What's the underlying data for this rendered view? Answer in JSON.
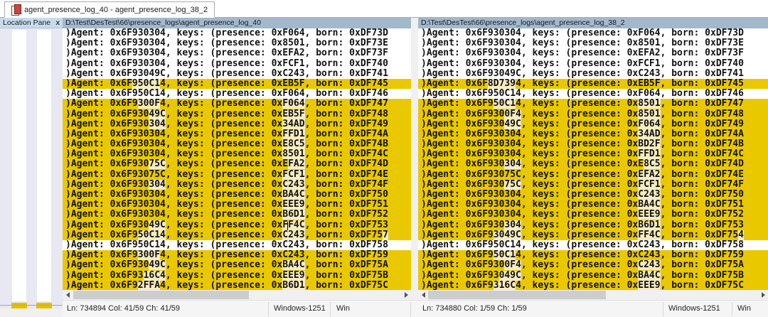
{
  "window": {
    "tab_title": "agent_presence_log_40 - agent_presence_log_38_2"
  },
  "location_pane": {
    "title": "Location Pane",
    "close_label": "x"
  },
  "colors": {
    "diff_background": "#EAC800",
    "word_diff_background": "#F6ECC0",
    "header_background": "#A3B8CC",
    "location_marker": "#E3C000"
  },
  "panes": [
    {
      "path": "D:\\Test\\DesTest\\66\\presence_logs\\agent_presence_log_40",
      "status": {
        "line_info": "Ln: 734894  Col: 41/59  Ch: 41/59",
        "encoding": "Windows-1251",
        "eol": "Win"
      },
      "lines": [
        {
          "d": 0,
          "s": [
            [
              ")Agent: 0x6F930304, keys: (presence: 0xF064, born: 0xDF73D",
              0
            ]
          ]
        },
        {
          "d": 0,
          "s": [
            [
              ")Agent: 0x6F930304, keys: (presence: 0x8501, born: 0xDF73E",
              0
            ]
          ]
        },
        {
          "d": 0,
          "s": [
            [
              ")Agent: 0x6F930304, keys: (presence: 0xEFA2, born: 0xDF73F",
              0
            ]
          ]
        },
        {
          "d": 0,
          "s": [
            [
              ")Agent: 0x6F930304, keys: (presence: 0xFCF1, born: 0xDF740",
              0
            ]
          ]
        },
        {
          "d": 0,
          "s": [
            [
              ")Agent: 0x6F93049C, keys: (presence: 0xC243, born: 0xDF741",
              0
            ]
          ]
        },
        {
          "d": 1,
          "s": [
            [
              ")Agent: 0x6F",
              0
            ],
            [
              "950C1",
              1
            ],
            [
              "4, keys: (presence: 0xEB5F, born: 0xDF745",
              0
            ]
          ]
        },
        {
          "d": 0,
          "s": [
            [
              ")Agent: 0x6F950C14, keys: (presence: 0xF064, born: 0xDF746",
              0
            ]
          ]
        },
        {
          "d": 1,
          "s": [
            [
              ")Agent: 0x6F9",
              0
            ],
            [
              "300F",
              1
            ],
            [
              "4, keys: (presence: 0x",
              0
            ],
            [
              "F064",
              1
            ],
            [
              ", born: 0xDF747",
              0
            ]
          ]
        },
        {
          "d": 1,
          "s": [
            [
              ")Agent: 0x6F930",
              0
            ],
            [
              "49C",
              1
            ],
            [
              ", keys: (presence: 0x",
              0
            ],
            [
              "EB5F",
              1
            ],
            [
              ", born: 0xDF748",
              0
            ]
          ]
        },
        {
          "d": 1,
          "s": [
            [
              ")Agent: 0x6F930",
              0
            ],
            [
              "304",
              1
            ],
            [
              ", keys: (presence: 0x",
              0
            ],
            [
              "34AD",
              1
            ],
            [
              ", born: 0xDF749",
              0
            ]
          ]
        },
        {
          "d": 1,
          "s": [
            [
              ")Agent: 0x6F930304, keys: (presence: 0x",
              0
            ],
            [
              "FFD1",
              1
            ],
            [
              ", born: 0xDF74A",
              0
            ]
          ]
        },
        {
          "d": 1,
          "s": [
            [
              ")Agent: 0x6F930304, keys: (presence: 0x",
              0
            ],
            [
              "E8C5",
              1
            ],
            [
              ", born: 0xDF74B",
              0
            ]
          ]
        },
        {
          "d": 1,
          "s": [
            [
              ")Agent: 0x6F930304, keys: (presence: 0x",
              0
            ],
            [
              "8501",
              1
            ],
            [
              ", born: 0xDF74C",
              0
            ]
          ]
        },
        {
          "d": 1,
          "s": [
            [
              ")Agent: 0x6F930",
              0
            ],
            [
              "75C",
              1
            ],
            [
              ", keys: (presence: 0xE",
              0
            ],
            [
              "FA2",
              1
            ],
            [
              ", born: 0xDF74D",
              0
            ]
          ]
        },
        {
          "d": 1,
          "s": [
            [
              ")Agent: 0x6F93075C, keys: (presence: 0x",
              0
            ],
            [
              "FCF1",
              1
            ],
            [
              ", born: 0xDF74E",
              0
            ]
          ]
        },
        {
          "d": 1,
          "s": [
            [
              ")Agent: 0x6F930",
              0
            ],
            [
              "304",
              1
            ],
            [
              ", keys: (presence: 0x",
              0
            ],
            [
              "C243",
              1
            ],
            [
              ", born: 0xDF74F",
              0
            ]
          ]
        },
        {
          "d": 1,
          "s": [
            [
              ")Agent: 0x6F930304, keys: (presence: 0x",
              0
            ],
            [
              "BA4C",
              1
            ],
            [
              ", born: 0xDF750",
              0
            ]
          ]
        },
        {
          "d": 1,
          "s": [
            [
              ")Agent: 0x6F930304, keys: (presence: 0x",
              0
            ],
            [
              "EEE9",
              1
            ],
            [
              ", born: 0xDF751",
              0
            ]
          ]
        },
        {
          "d": 1,
          "s": [
            [
              ")Agent: 0x6F930304, keys: (presence: 0x",
              0
            ],
            [
              "B6D1",
              1
            ],
            [
              ", born: 0xDF752",
              0
            ]
          ]
        },
        {
          "d": 1,
          "s": [
            [
              ")Agent: 0x6F930",
              0
            ],
            [
              "49C",
              1
            ],
            [
              ", keys: (presence: 0x",
              0
            ],
            [
              "F",
              1
            ],
            [
              "",
              2
            ],
            [
              "F4C",
              1
            ],
            [
              ", born: 0xDF753",
              0
            ]
          ]
        },
        {
          "d": 1,
          "s": [
            [
              ")Agent: 0x6F9",
              0
            ],
            [
              "50C14",
              1
            ],
            [
              ", keys: (presence: 0x",
              0
            ],
            [
              "C243",
              1
            ],
            [
              ", born: 0xDF75",
              0
            ],
            [
              "7",
              1
            ]
          ]
        },
        {
          "d": 0,
          "s": [
            [
              ")Agent: 0x6F950C14, keys: (presence: 0xC243, born: 0xDF758",
              0
            ]
          ]
        },
        {
          "d": 1,
          "s": [
            [
              ")Agent: 0x6F9",
              0
            ],
            [
              "300F",
              1
            ],
            [
              "4, keys: (presence: 0xC243, born: 0xDF759",
              0
            ]
          ]
        },
        {
          "d": 1,
          "s": [
            [
              ")Agent: 0x6F930",
              0
            ],
            [
              "49C",
              1
            ],
            [
              ", keys: (presence: 0x",
              0
            ],
            [
              "BA4C",
              1
            ],
            [
              ", born: 0xDF75A",
              0
            ]
          ]
        },
        {
          "d": 1,
          "s": [
            [
              ")Agent: 0x6F93",
              0
            ],
            [
              "16C4",
              1
            ],
            [
              ", keys: (presence: 0x",
              0
            ],
            [
              "EEE9",
              1
            ],
            [
              ", born: 0xDF75B",
              0
            ]
          ]
        },
        {
          "d": 1,
          "s": [
            [
              ")Agent: 0x6F9",
              0
            ],
            [
              "2FFA",
              1
            ],
            [
              "4, keys: (presence: 0x",
              0
            ],
            [
              "B6D1",
              1
            ],
            [
              ", born: 0xDF75C",
              0
            ]
          ]
        }
      ]
    },
    {
      "path": "D:\\Test\\DesTest\\66\\presence_logs\\agent_presence_log_38_2",
      "status": {
        "line_info": "Ln: 734880  Col: 1/59  Ch: 1/59",
        "encoding": "Windows-1251",
        "eol": "Win"
      },
      "lines": [
        {
          "d": 0,
          "s": [
            [
              ")Agent: 0x6F930304, keys: (presence: 0xF064, born: 0xDF73D",
              0
            ]
          ]
        },
        {
          "d": 0,
          "s": [
            [
              ")Agent: 0x6F930304, keys: (presence: 0x8501, born: 0xDF73E",
              0
            ]
          ]
        },
        {
          "d": 0,
          "s": [
            [
              ")Agent: 0x6F930304, keys: (presence: 0xEFA2, born: 0xDF73F",
              0
            ]
          ]
        },
        {
          "d": 0,
          "s": [
            [
              ")Agent: 0x6F930304, keys: (presence: 0xFCF1, born: 0xDF740",
              0
            ]
          ]
        },
        {
          "d": 0,
          "s": [
            [
              ")Agent: 0x6F93049C, keys: (presence: 0xC243, born: 0xDF741",
              0
            ]
          ]
        },
        {
          "d": 1,
          "s": [
            [
              ")Agent: 0x6F",
              0
            ],
            [
              "8D739",
              1
            ],
            [
              "4, keys: (presence: 0xEB5F, born: 0xDF745",
              0
            ]
          ]
        },
        {
          "d": 0,
          "s": [
            [
              ")Agent: 0x6F950C14, keys: (presence: 0xF064, born: 0xDF746",
              0
            ]
          ]
        },
        {
          "d": 1,
          "s": [
            [
              ")Agent: 0x6F9",
              0
            ],
            [
              "50C1",
              1
            ],
            [
              "4, keys: (presence: 0x",
              0
            ],
            [
              "8501",
              1
            ],
            [
              ", born: 0xDF747",
              0
            ]
          ]
        },
        {
          "d": 1,
          "s": [
            [
              ")Agent: 0x6F930",
              0
            ],
            [
              "0F4",
              1
            ],
            [
              ", keys: (presence: 0x",
              0
            ],
            [
              "8501",
              1
            ],
            [
              ", born: 0xDF748",
              0
            ]
          ]
        },
        {
          "d": 1,
          "s": [
            [
              ")Agent: 0x6F930",
              0
            ],
            [
              "49C",
              1
            ],
            [
              ", keys: (presence: 0x",
              0
            ],
            [
              "F064",
              1
            ],
            [
              ", born: 0xDF749",
              0
            ]
          ]
        },
        {
          "d": 1,
          "s": [
            [
              ")Agent: 0x6F930304, keys: (presence: 0x",
              0
            ],
            [
              "34AD",
              1
            ],
            [
              ", born: 0xDF74A",
              0
            ]
          ]
        },
        {
          "d": 1,
          "s": [
            [
              ")Agent: 0x6F930304, keys: (presence: 0x",
              0
            ],
            [
              "BD2F",
              1
            ],
            [
              ", born: 0xDF74B",
              0
            ]
          ]
        },
        {
          "d": 1,
          "s": [
            [
              ")Agent: 0x6F930304, keys: (presence: 0x",
              0
            ],
            [
              "FFD1",
              1
            ],
            [
              ", born: 0xDF74C",
              0
            ]
          ]
        },
        {
          "d": 1,
          "s": [
            [
              ")Agent: 0x6F930",
              0
            ],
            [
              "304",
              1
            ],
            [
              ", keys: (presence: 0xE",
              0
            ],
            [
              "8C5",
              1
            ],
            [
              ", born: 0xDF74D",
              0
            ]
          ]
        },
        {
          "d": 1,
          "s": [
            [
              ")Agent: 0x6F93075C, keys: (presence: 0x",
              0
            ],
            [
              "EFA2",
              1
            ],
            [
              ", born: 0xDF74E",
              0
            ]
          ]
        },
        {
          "d": 1,
          "s": [
            [
              ")Agent: 0x6F930",
              0
            ],
            [
              "75C",
              1
            ],
            [
              ", keys: (presence: 0x",
              0
            ],
            [
              "FCF1",
              1
            ],
            [
              ", born: 0xDF74F",
              0
            ]
          ]
        },
        {
          "d": 1,
          "s": [
            [
              ")Agent: 0x6F930304, keys: (presence: 0x",
              0
            ],
            [
              "C243",
              1
            ],
            [
              ", born: 0xDF750",
              0
            ]
          ]
        },
        {
          "d": 1,
          "s": [
            [
              ")Agent: 0x6F930304, keys: (presence: 0x",
              0
            ],
            [
              "BA4C",
              1
            ],
            [
              ", born: 0xDF751",
              0
            ]
          ]
        },
        {
          "d": 1,
          "s": [
            [
              ")Agent: 0x6F930304, keys: (presence: 0x",
              0
            ],
            [
              "EEE9",
              1
            ],
            [
              ", born: 0xDF752",
              0
            ]
          ]
        },
        {
          "d": 1,
          "s": [
            [
              ")Agent: 0x6F930",
              0
            ],
            [
              "304",
              1
            ],
            [
              ", keys: (presence: 0x",
              0
            ],
            [
              "B6D1",
              1
            ],
            [
              ", born: 0xDF753",
              0
            ]
          ]
        },
        {
          "d": 1,
          "s": [
            [
              ")Agent: 0x6F9",
              0
            ],
            [
              "3049C",
              1
            ],
            [
              ", keys: (presence: 0x",
              0
            ],
            [
              "FF4C",
              1
            ],
            [
              ", born: 0xDF75",
              0
            ],
            [
              "4",
              1
            ]
          ]
        },
        {
          "d": 0,
          "s": [
            [
              ")Agent: 0x6F950C14, keys: (presence: 0xC243, born: 0xDF758",
              0
            ]
          ]
        },
        {
          "d": 1,
          "s": [
            [
              ")Agent: 0x6F9",
              0
            ],
            [
              "50C1",
              1
            ],
            [
              "4, keys: (presence: 0xC243, born: 0xDF759",
              0
            ]
          ]
        },
        {
          "d": 1,
          "s": [
            [
              ")Agent: 0x6F930",
              0
            ],
            [
              "0F4",
              1
            ],
            [
              ", keys: (presence: 0x",
              0
            ],
            [
              "C243",
              1
            ],
            [
              ", born: 0xDF75A",
              0
            ]
          ]
        },
        {
          "d": 1,
          "s": [
            [
              ")Agent: 0x6F93",
              0
            ],
            [
              "049C",
              1
            ],
            [
              ", keys: (presence: 0x",
              0
            ],
            [
              "BA4C",
              1
            ],
            [
              ", born: 0xDF75B",
              0
            ]
          ]
        },
        {
          "d": 1,
          "s": [
            [
              ")Agent: 0x6F9",
              0
            ],
            [
              "316C",
              1
            ],
            [
              "4, keys: (presence: 0x",
              0
            ],
            [
              "EEE9",
              1
            ],
            [
              ", born: 0xDF75C",
              0
            ]
          ]
        }
      ]
    }
  ]
}
